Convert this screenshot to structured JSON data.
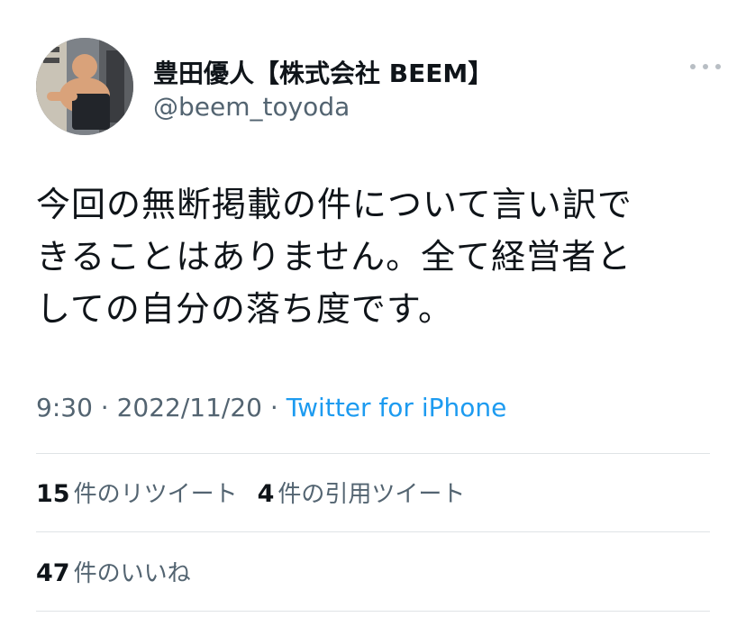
{
  "author": {
    "display_name": "豊田優人【株式会社 BEEM】",
    "handle": "@beem_toyoda"
  },
  "tweet": {
    "lines": [
      "今回の無断掲載の件について言い訳で",
      "きることはありません。全て経営者と",
      "しての自分の落ち度です。"
    ]
  },
  "meta": {
    "time": "9:30",
    "separator": " · ",
    "date": "2022/11/20",
    "source": "Twitter for iPhone"
  },
  "stats": {
    "retweets_count": "15",
    "retweets_label": "件のリツイート",
    "quotes_count": "4",
    "quotes_label": "件の引用ツイート",
    "likes_count": "47",
    "likes_label": "件のいいね"
  },
  "icons": {
    "more": "more-options-icon"
  },
  "colors": {
    "link": "#1d9bf0",
    "secondary_text": "#536471",
    "primary_text": "#0f1419",
    "divider": "#dfe3e6"
  }
}
